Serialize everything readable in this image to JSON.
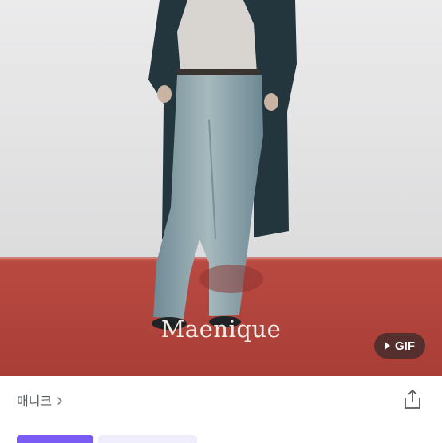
{
  "hero": {
    "alt": "model wearing wide-leg washed denim jeans and long coat",
    "watermark_text": "Maenique",
    "gif_badge_label": "GIF",
    "colors": {
      "wall": "#e8e8e9",
      "floor": "#b5473f",
      "coat": "#24363d",
      "denim": "#8ea5ad",
      "sweater": "#d8d4cf"
    }
  },
  "shop": {
    "name": "매니크",
    "chevron": "›"
  },
  "icons": {
    "share": "share-icon",
    "gif_play": "play-icon",
    "chevron": "chevron-right-icon"
  },
  "chips": {
    "primary_color": "#7a5cf5",
    "secondary_color": "#f0eefc"
  }
}
